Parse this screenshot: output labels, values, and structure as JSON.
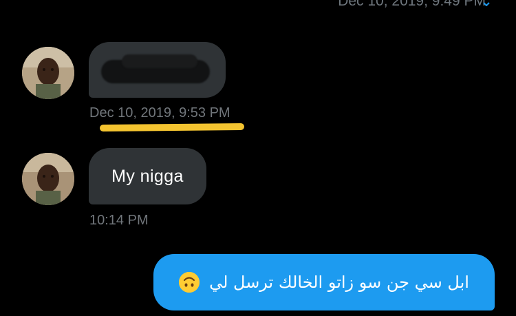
{
  "conversation": {
    "top_partial_timestamp": "Dec 10, 2019, 9:49 PM",
    "messages": [
      {
        "direction": "incoming",
        "text": "",
        "redacted": true,
        "timestamp": "Dec 10, 2019, 9:53 PM",
        "timestamp_highlighted": true
      },
      {
        "direction": "incoming",
        "text": "My nigga",
        "timestamp": "10:14 PM"
      },
      {
        "direction": "outgoing",
        "text": "ابل سي جن سو زاتو الخالك ترسل لي",
        "emoji": "upside-down-face"
      }
    ]
  },
  "colors": {
    "background": "#000000",
    "incoming_bubble": "#2f3336",
    "outgoing_bubble": "#1d9bf0",
    "timestamp_text": "#71767b",
    "highlight_marker": "#f4c430"
  }
}
